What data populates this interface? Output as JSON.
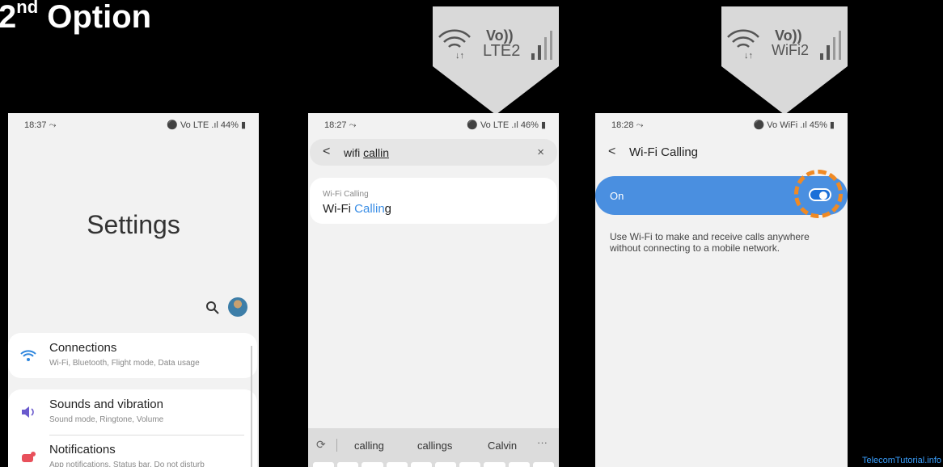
{
  "slide": {
    "title_main": "2",
    "title_sup": "nd",
    "title_rest": " Option"
  },
  "callout_lte": {
    "top": "Vo))",
    "bottom": "LTE2"
  },
  "callout_wifi": {
    "top": "Vo))",
    "bottom": "WiFi2"
  },
  "phone1": {
    "status": {
      "time": "18:37 ⤳",
      "right": "⚫ Vo LTE .ıl 44% ▮"
    },
    "title": "Settings",
    "items": [
      {
        "label": "Connections",
        "sub": "Wi-Fi, Bluetooth, Flight mode, Data usage",
        "icon": "wifi-icon"
      },
      {
        "label": "Sounds and vibration",
        "sub": "Sound mode, Ringtone, Volume",
        "icon": "volume-icon"
      },
      {
        "label": "Notifications",
        "sub": "App notifications, Status bar, Do not disturb",
        "icon": "notification-icon"
      }
    ]
  },
  "phone2": {
    "status": {
      "time": "18:27 ⤳",
      "right": "⚫ Vo LTE .ıl 46% ▮"
    },
    "search": {
      "prefix": "wifi ",
      "underlined": "callin",
      "clear": "×",
      "back": "<"
    },
    "result": {
      "category": "Wi-Fi Calling",
      "title_plain": "Wi-Fi ",
      "title_highlight": "Callin",
      "title_tail": "g"
    },
    "keyboard": {
      "suggestions": [
        "calling",
        "callings",
        "Calvin"
      ],
      "more": "···",
      "clip": "⟳"
    }
  },
  "phone3": {
    "status": {
      "time": "18:28 ⤳",
      "right": "⚫ Vo WiFi .ıl 45% ▮"
    },
    "back": "<",
    "title": "Wi-Fi Calling",
    "on_label": "On",
    "toggle_state": "on",
    "description": "Use Wi-Fi to make and receive calls anywhere without connecting to a mobile network."
  },
  "watermark": "TelecomTutorial.info",
  "colors": {
    "accent": "#4a8fe0",
    "highlight_ring": "#f08a24",
    "link_blue": "#3a8ee6"
  }
}
